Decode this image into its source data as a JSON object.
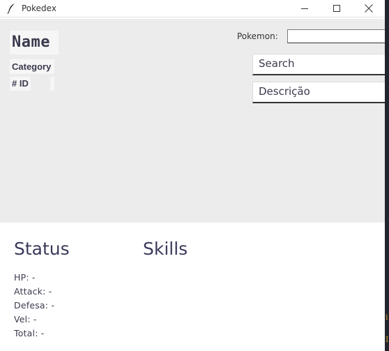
{
  "window": {
    "title": "Pokedex",
    "controls": [
      "minimize",
      "maximize",
      "close"
    ]
  },
  "header": {
    "name": "Name",
    "category": "Category",
    "id": "# ID"
  },
  "search": {
    "pokemon_label": "Pokemon:",
    "pokemon_value": "",
    "search_text": "Search",
    "description_text": "Descrição"
  },
  "status": {
    "title": "Status",
    "lines": [
      "HP: -",
      "Attack: -",
      "Defesa: -",
      "Vel: -",
      "Total: -"
    ]
  },
  "skills": {
    "title": "Skills"
  },
  "right_edge": {
    "glyph_a": "i",
    "glyph_b": "I"
  },
  "colors": {
    "panel_bg": "#ececec",
    "text_dark": "#3a3a4e",
    "edge_bg": "#23252e"
  }
}
